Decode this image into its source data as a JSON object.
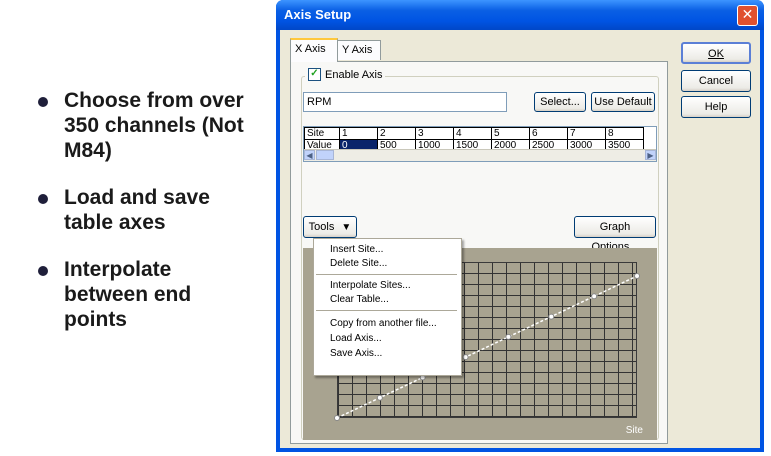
{
  "bullets": [
    {
      "text": "Choose from over 350 channels (Not M84)"
    },
    {
      "text": "Load and save table axes"
    },
    {
      "text": "Interpolate between end points"
    }
  ],
  "window": {
    "title": "Axis Setup",
    "close_label": "✕"
  },
  "tabs": [
    {
      "label": "X Axis",
      "active": true
    },
    {
      "label": "Y Axis",
      "active": false
    }
  ],
  "buttons": {
    "ok": "OK",
    "cancel": "Cancel",
    "help": "Help",
    "select": "Select...",
    "use_default": "Use Default",
    "tools": "Tools",
    "graph_options": "Graph Options..."
  },
  "enable_axis": {
    "label": "Enable Axis",
    "checked": true
  },
  "channel_value": "RPM",
  "table": {
    "row_headers": [
      "Site",
      "Value"
    ],
    "sites": [
      "1",
      "2",
      "3",
      "4",
      "5",
      "6",
      "7",
      "8"
    ],
    "values": [
      "0",
      "500",
      "1000",
      "1500",
      "2000",
      "2500",
      "3000",
      "3500"
    ]
  },
  "tools_menu": {
    "groups": [
      [
        "Insert Site...",
        "Delete Site..."
      ],
      [
        "Interpolate Sites...",
        "Clear Table..."
      ],
      [
        "Copy from another file...",
        "Load Axis...",
        "Save Axis..."
      ]
    ]
  },
  "graph": {
    "x_label": "Site",
    "points": [
      [
        0,
        0
      ],
      [
        1,
        500
      ],
      [
        2,
        1000
      ],
      [
        3,
        1500
      ],
      [
        4,
        2000
      ],
      [
        5,
        2500
      ],
      [
        6,
        3000
      ],
      [
        7,
        3500
      ]
    ],
    "background": "#a8a390",
    "line_color": "#ffffff"
  },
  "colors": {
    "title_bar": "#0054e3",
    "dialog_face": "#ece9d8",
    "selection": "#0a246a"
  }
}
